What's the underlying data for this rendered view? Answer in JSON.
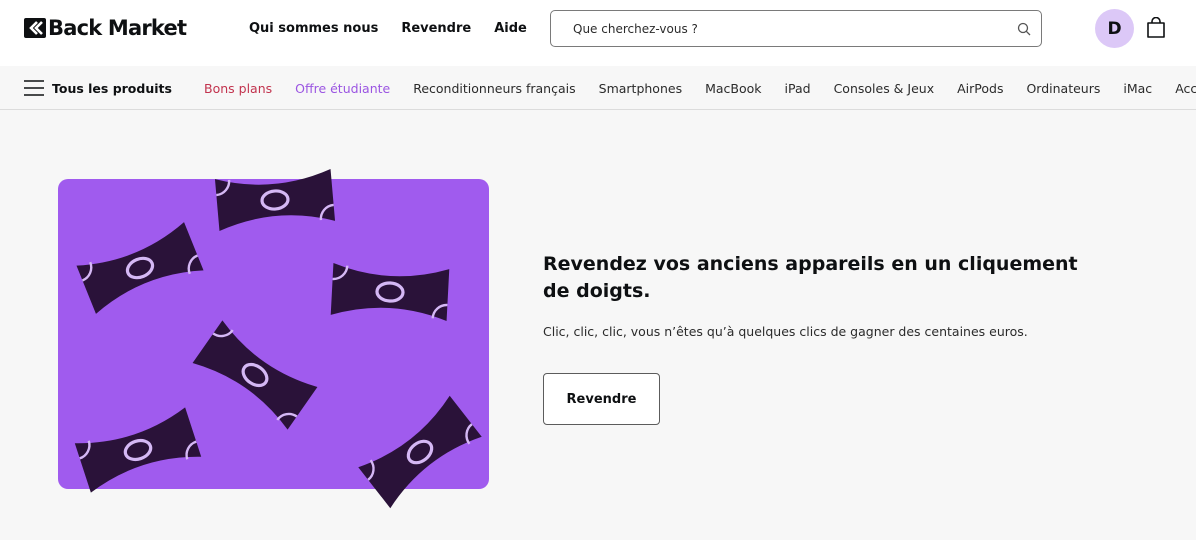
{
  "header": {
    "brand": "Back Market",
    "nav": [
      {
        "label": "Qui sommes nous"
      },
      {
        "label": "Revendre"
      },
      {
        "label": "Aide"
      }
    ],
    "search": {
      "placeholder": "Que cherchez-vous ?"
    },
    "avatar_initial": "D"
  },
  "categories": {
    "menu_label": "Tous les produits",
    "items": [
      {
        "label": "Bons plans",
        "color": "#c2334e"
      },
      {
        "label": "Offre étudiante",
        "color": "#9b55e2"
      },
      {
        "label": "Reconditionneurs français"
      },
      {
        "label": "Smartphones"
      },
      {
        "label": "MacBook"
      },
      {
        "label": "iPad"
      },
      {
        "label": "Consoles & Jeux"
      },
      {
        "label": "AirPods"
      },
      {
        "label": "Ordinateurs"
      },
      {
        "label": "iMac"
      },
      {
        "label": "Accessoires"
      }
    ]
  },
  "hero": {
    "title": "Revendez vos anciens appareils en un cliquement de doigts.",
    "subtitle": "Clic, clic, clic, vous n’êtes qu’à quelques clics de gagner des centaines euros.",
    "button_label": "Revendre",
    "card_color": "#a05bee",
    "bill_color": "#2a1239"
  }
}
